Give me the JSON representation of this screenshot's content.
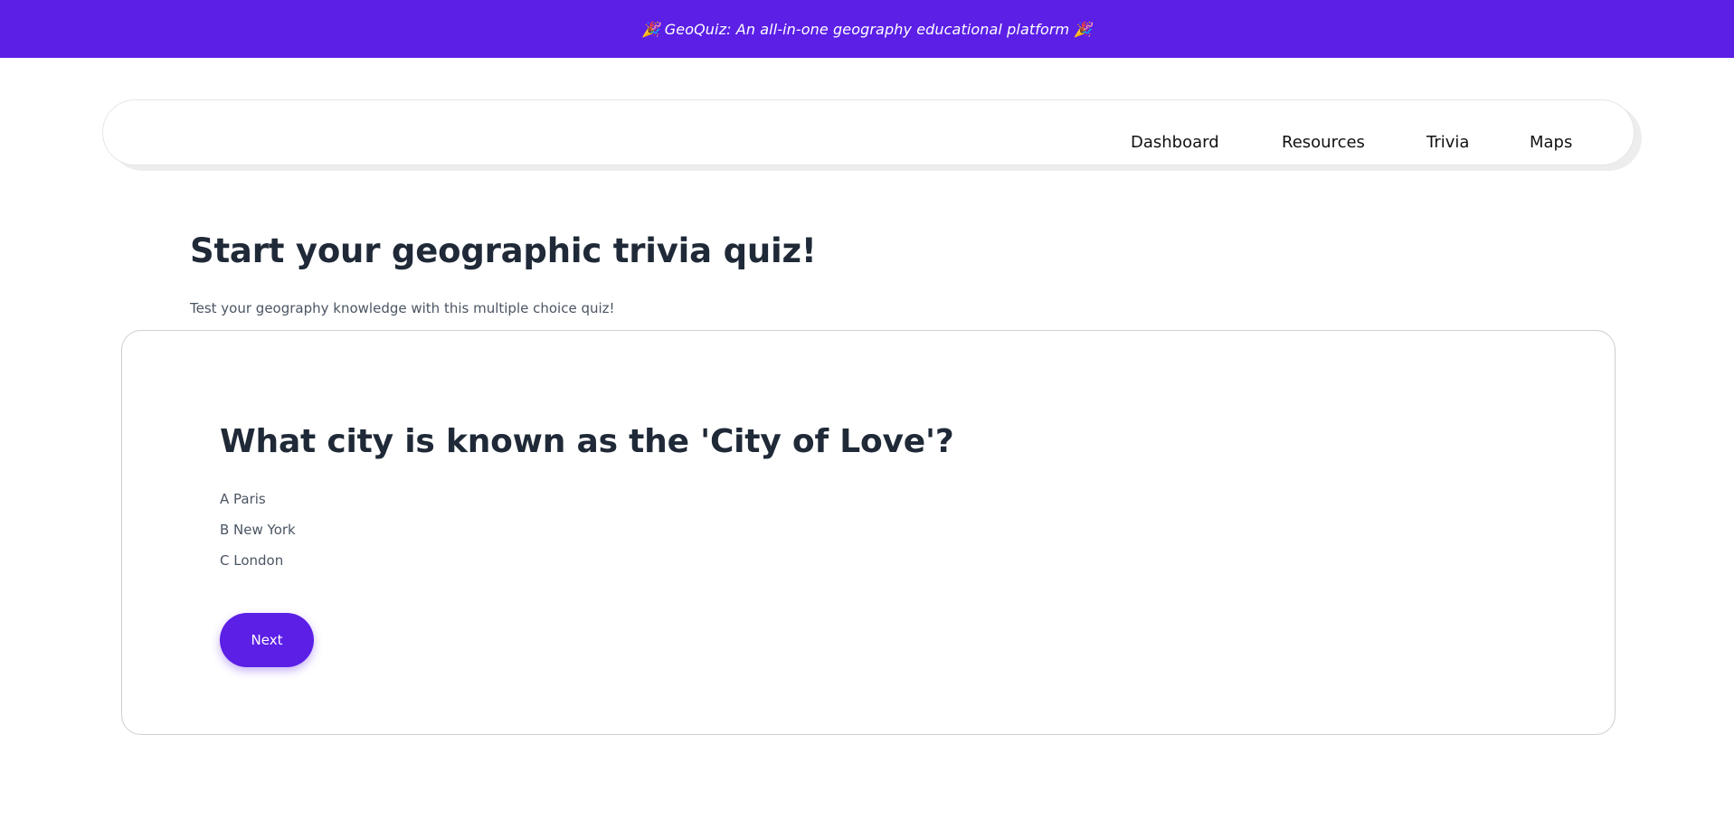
{
  "banner": {
    "text": "🎉 GeoQuiz: An all-in-one geography educational platform 🎉"
  },
  "nav": {
    "items": [
      {
        "label": "Dashboard"
      },
      {
        "label": "Resources"
      },
      {
        "label": "Trivia"
      },
      {
        "label": "Maps"
      }
    ]
  },
  "main": {
    "title": "Start your geographic trivia quiz!",
    "subtitle": "Test your geography knowledge with this multiple choice quiz!"
  },
  "quiz": {
    "question": "What city is known as the 'City of Love'?",
    "options": [
      {
        "label": "A Paris"
      },
      {
        "label": "B New York"
      },
      {
        "label": "C London"
      }
    ],
    "next_label": "Next"
  },
  "colors": {
    "accent": "#5b1fe6",
    "heading": "#1f2937",
    "muted_text": "#4b5563"
  }
}
